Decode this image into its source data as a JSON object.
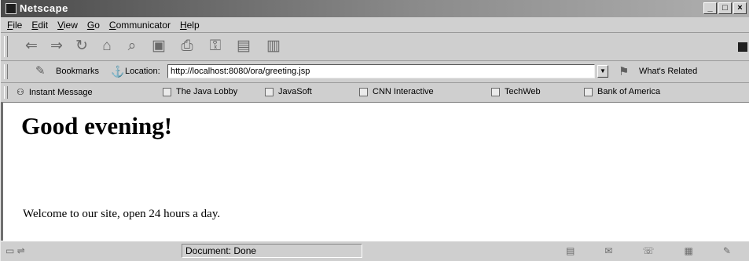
{
  "window": {
    "title": "Netscape",
    "controls": [
      "_",
      "□",
      "×"
    ]
  },
  "menu": [
    "File",
    "Edit",
    "View",
    "Go",
    "Communicator",
    "Help"
  ],
  "navigation": {
    "buttons": [
      "back-icon",
      "forward-icon",
      "reload-icon",
      "home-icon",
      "search-icon",
      "guide-icon",
      "print-icon",
      "security-icon",
      "shop-icon",
      "stop-icon"
    ]
  },
  "location": {
    "bookmarks_label": "Bookmarks",
    "location_label": "Location:",
    "url": "http://localhost:8080/ora/greeting.jsp",
    "related_label": "What's Related"
  },
  "personal_toolbar": {
    "items": [
      "Instant Message",
      "The Java Lobby",
      "JavaSoft",
      "CNN Interactive",
      "TechWeb",
      "Bank of America"
    ]
  },
  "page": {
    "heading": "Good evening!",
    "body": "Welcome to our site, open 24 hours a day."
  },
  "status": {
    "text": "Document: Done"
  }
}
